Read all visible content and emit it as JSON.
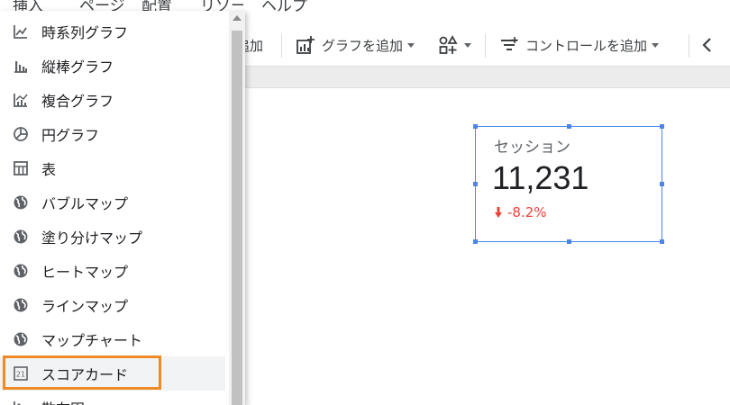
{
  "menubar": {
    "insert": "挿入",
    "page": "ページ",
    "arrange": "配置",
    "resource": "リソース",
    "help": "ヘルプ"
  },
  "toolbar": {
    "add_partial": "追加",
    "add_chart": "グラフを追加",
    "add_control": "コントロールを追加"
  },
  "dropdown": {
    "items": [
      {
        "label": "時系列グラフ",
        "icon": "line-chart-icon"
      },
      {
        "label": "縦棒グラフ",
        "icon": "bar-chart-icon"
      },
      {
        "label": "複合グラフ",
        "icon": "combo-chart-icon"
      },
      {
        "label": "円グラフ",
        "icon": "pie-chart-icon"
      },
      {
        "label": "表",
        "icon": "table-icon"
      },
      {
        "label": "バブルマップ",
        "icon": "globe-icon"
      },
      {
        "label": "塗り分けマップ",
        "icon": "globe-icon"
      },
      {
        "label": "ヒートマップ",
        "icon": "globe-icon"
      },
      {
        "label": "ラインマップ",
        "icon": "globe-icon"
      },
      {
        "label": "マップチャート",
        "icon": "globe-icon"
      },
      {
        "label": "スコアカード",
        "icon": "scorecard-icon"
      },
      {
        "label": "散布図",
        "icon": "scatter-icon"
      }
    ],
    "highlight_color": "#f08a24"
  },
  "scorecard": {
    "label": "セッション",
    "value": "11,231",
    "delta": "-8.2%",
    "delta_color": "#e8453c",
    "border_color": "#4a86e8"
  }
}
